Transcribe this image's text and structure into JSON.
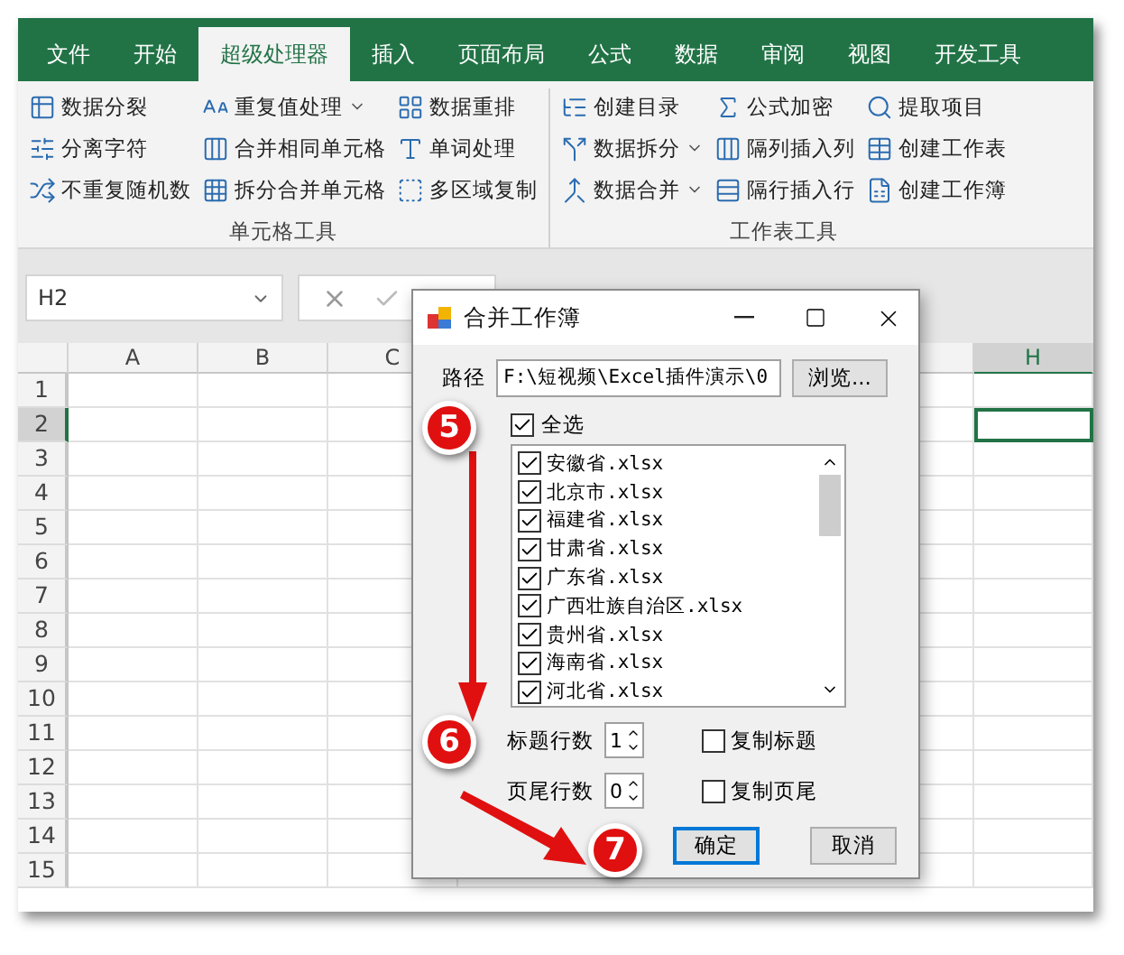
{
  "tabs": [
    {
      "label": "文件",
      "selected": false
    },
    {
      "label": "开始",
      "selected": false
    },
    {
      "label": "超级处理器",
      "selected": true
    },
    {
      "label": "插入",
      "selected": false
    },
    {
      "label": "页面布局",
      "selected": false
    },
    {
      "label": "公式",
      "selected": false
    },
    {
      "label": "数据",
      "selected": false
    },
    {
      "label": "审阅",
      "selected": false
    },
    {
      "label": "视图",
      "selected": false
    },
    {
      "label": "开发工具",
      "selected": false
    }
  ],
  "ribbon": {
    "groups": [
      {
        "label": "单元格工具",
        "columns": [
          [
            {
              "label": "数据分裂",
              "dropdown": false
            },
            {
              "label": "分离字符",
              "dropdown": false
            },
            {
              "label": "不重复随机数",
              "dropdown": false
            }
          ],
          [
            {
              "label": "重复值处理",
              "dropdown": true
            },
            {
              "label": "合并相同单元格",
              "dropdown": false
            },
            {
              "label": "拆分合并单元格",
              "dropdown": false
            }
          ],
          [
            {
              "label": "数据重排",
              "dropdown": false
            },
            {
              "label": "单词处理",
              "dropdown": false
            },
            {
              "label": "多区域复制",
              "dropdown": false
            }
          ]
        ]
      },
      {
        "label": "工作表工具",
        "columns": [
          [
            {
              "label": "创建目录",
              "dropdown": false
            },
            {
              "label": "数据拆分",
              "dropdown": true
            },
            {
              "label": "数据合并",
              "dropdown": true
            }
          ],
          [
            {
              "label": "公式加密",
              "dropdown": false
            },
            {
              "label": "隔列插入列",
              "dropdown": false
            },
            {
              "label": "隔行插入行",
              "dropdown": false
            }
          ],
          [
            {
              "label": "提取项目",
              "dropdown": false
            },
            {
              "label": "创建工作表",
              "dropdown": false
            },
            {
              "label": "创建工作簿",
              "dropdown": false
            }
          ]
        ]
      }
    ]
  },
  "name_box": "H2",
  "sheet": {
    "columns": [
      {
        "label": "A",
        "selected": false
      },
      {
        "label": "B",
        "selected": false
      },
      {
        "label": "C",
        "selected": false
      },
      {
        "label": "H",
        "selected": true
      }
    ],
    "rows": [
      {
        "label": "1",
        "selected": false
      },
      {
        "label": "2",
        "selected": true
      },
      {
        "label": "3",
        "selected": false
      },
      {
        "label": "4",
        "selected": false
      },
      {
        "label": "5",
        "selected": false
      },
      {
        "label": "6",
        "selected": false
      },
      {
        "label": "7",
        "selected": false
      },
      {
        "label": "8",
        "selected": false
      },
      {
        "label": "9",
        "selected": false
      },
      {
        "label": "10",
        "selected": false
      },
      {
        "label": "11",
        "selected": false
      },
      {
        "label": "12",
        "selected": false
      },
      {
        "label": "13",
        "selected": false
      },
      {
        "label": "14",
        "selected": false
      },
      {
        "label": "15",
        "selected": false
      }
    ]
  },
  "dialog": {
    "title": "合并工作簿",
    "path_label": "路径",
    "path_value": "F:\\短视频\\Excel插件演示\\0",
    "browse": "浏览...",
    "select_all": {
      "label": "全选",
      "checked": true
    },
    "files": [
      {
        "label": "安徽省.xlsx",
        "checked": true
      },
      {
        "label": "北京市.xlsx",
        "checked": true
      },
      {
        "label": "福建省.xlsx",
        "checked": true
      },
      {
        "label": "甘肃省.xlsx",
        "checked": true
      },
      {
        "label": "广东省.xlsx",
        "checked": true
      },
      {
        "label": "广西壮族自治区.xlsx",
        "checked": true
      },
      {
        "label": "贵州省.xlsx",
        "checked": true
      },
      {
        "label": "海南省.xlsx",
        "checked": true
      },
      {
        "label": "河北省.xlsx",
        "checked": true
      }
    ],
    "settings": [
      {
        "label": "标题行数",
        "value": "1",
        "copy_label": "复制标题",
        "copy_checked": false
      },
      {
        "label": "页尾行数",
        "value": "0",
        "copy_label": "复制页尾",
        "copy_checked": false
      }
    ],
    "buttons": [
      {
        "label": "确定",
        "default": true
      },
      {
        "label": "取消",
        "default": false
      }
    ]
  },
  "annotations": [
    {
      "label": "5"
    },
    {
      "label": "6"
    },
    {
      "label": "7"
    }
  ]
}
